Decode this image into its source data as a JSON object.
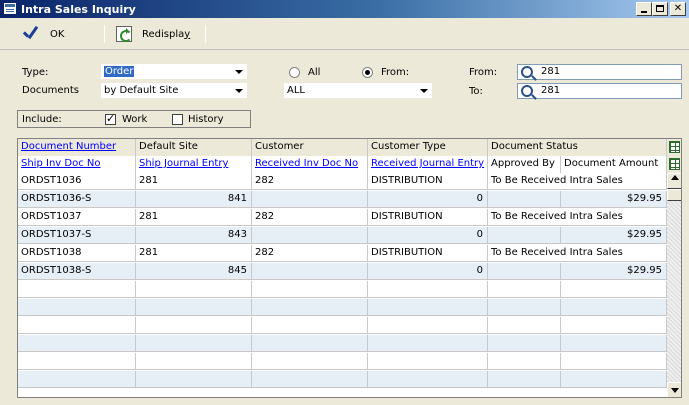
{
  "window": {
    "title": "Intra Sales Inquiry"
  },
  "toolbar": {
    "ok_label": "OK",
    "redisplay_label_pre": "Redispla",
    "redisplay_label_u": "y"
  },
  "form": {
    "type_label": "Type:",
    "type_value": "Order",
    "documents_label": "Documents",
    "documents_value": "by Default Site",
    "all_label": "All",
    "from_radio_label": "From:",
    "range_value": "ALL",
    "from_label": "From:",
    "from_value": "281",
    "to_label": "To:",
    "to_value": "281",
    "include_label": "Include:",
    "work_label": "Work",
    "history_label": "History",
    "work_checked": true,
    "history_checked": false,
    "range_selected": "From"
  },
  "grid": {
    "header1": [
      "Document Number",
      "Default Site",
      "Customer",
      "Customer Type",
      "Document Status"
    ],
    "header2": [
      "Ship Inv  Doc No",
      "Ship Journal Entry",
      "Received Inv Doc No",
      "Received Journal Entry",
      "Approved By",
      "Document Amount"
    ],
    "rows": [
      {
        "kind": "main",
        "c1": "ORDST1036",
        "c2": "281",
        "c3": "282",
        "c4": "DISTRIBUTION",
        "c5": "To Be Received Intra Sales"
      },
      {
        "kind": "sub",
        "c1": "ORDST1036-S",
        "c2": "841",
        "c4": "0",
        "c6": "$29.95"
      },
      {
        "kind": "main",
        "c1": "ORDST1037",
        "c2": "281",
        "c3": "282",
        "c4": "DISTRIBUTION",
        "c5": "To Be Received Intra Sales"
      },
      {
        "kind": "sub",
        "c1": "ORDST1037-S",
        "c2": "843",
        "c4": "0",
        "c6": "$29.95"
      },
      {
        "kind": "main",
        "c1": "ORDST1038",
        "c2": "281",
        "c3": "282",
        "c4": "DISTRIBUTION",
        "c5": "To Be Received Intra Sales"
      },
      {
        "kind": "sub",
        "c1": "ORDST1038-S",
        "c2": "845",
        "c4": "0",
        "c6": "$29.95"
      }
    ]
  },
  "colors": {
    "title_bar": "#0a246a",
    "link": "#0000ff",
    "alt_row": "#e6eef6",
    "selection": "#316ac5"
  },
  "icons": {
    "app": "window-icon",
    "ok": "checkmark-icon",
    "redisplay": "refresh-icon",
    "lookup": "magnifier-icon",
    "grid": "grid-icon"
  }
}
